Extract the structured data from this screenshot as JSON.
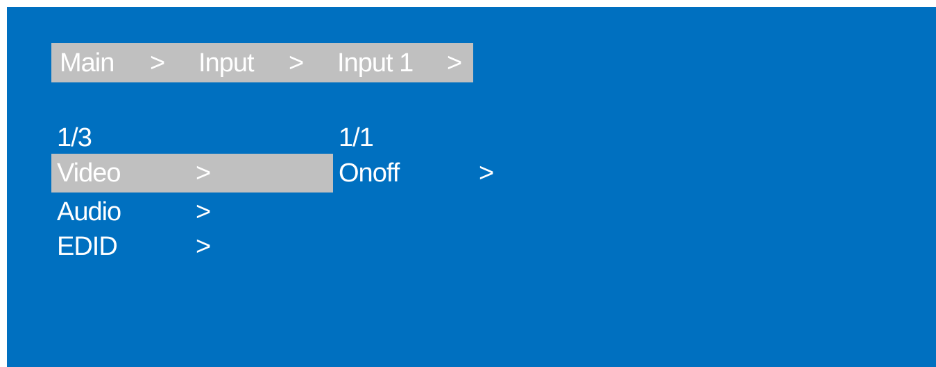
{
  "breadcrumb": {
    "items": [
      {
        "label": "Main",
        "separator": ">"
      },
      {
        "label": "Input",
        "separator": ">"
      },
      {
        "label": "Input 1",
        "separator": ">"
      }
    ]
  },
  "left_menu": {
    "page_indicator": "1/3",
    "items": [
      {
        "label": "Video",
        "arrow": ">",
        "selected": true
      },
      {
        "label": "Audio",
        "arrow": ">",
        "selected": false
      },
      {
        "label": "EDID",
        "arrow": ">",
        "selected": false
      }
    ]
  },
  "right_menu": {
    "page_indicator": "1/1",
    "items": [
      {
        "label": "Onoff",
        "arrow": ">",
        "selected": false
      }
    ]
  },
  "colors": {
    "background": "#0070c0",
    "highlight": "#c0c0c0",
    "text": "#ffffff"
  }
}
